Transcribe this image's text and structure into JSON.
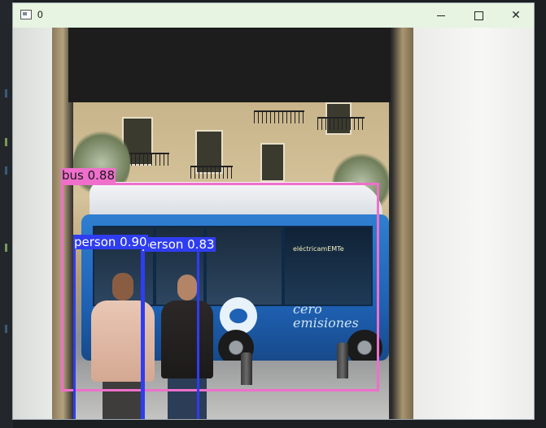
{
  "window": {
    "title": "0",
    "controls": {
      "minimize": "minimize",
      "maximize": "maximize",
      "close": "close"
    }
  },
  "scene": {
    "bus_logo_text": "eléctricamEMTe",
    "bus_side_text_line1": "cero",
    "bus_side_text_line2": "emisiones"
  },
  "detections": [
    {
      "label": "bus 0.88",
      "class": "bus",
      "score": 0.88,
      "color": "#ef6fcb"
    },
    {
      "label": "person 0.90",
      "class": "person",
      "score": 0.9,
      "color": "#2f3df0"
    },
    {
      "label": "person 0.83",
      "class": "person",
      "score": 0.83,
      "color": "#2f3df0"
    }
  ],
  "icons": {
    "app": "window-app-icon",
    "minimize": "minimize-icon",
    "maximize": "maximize-icon",
    "close": "close-icon"
  }
}
